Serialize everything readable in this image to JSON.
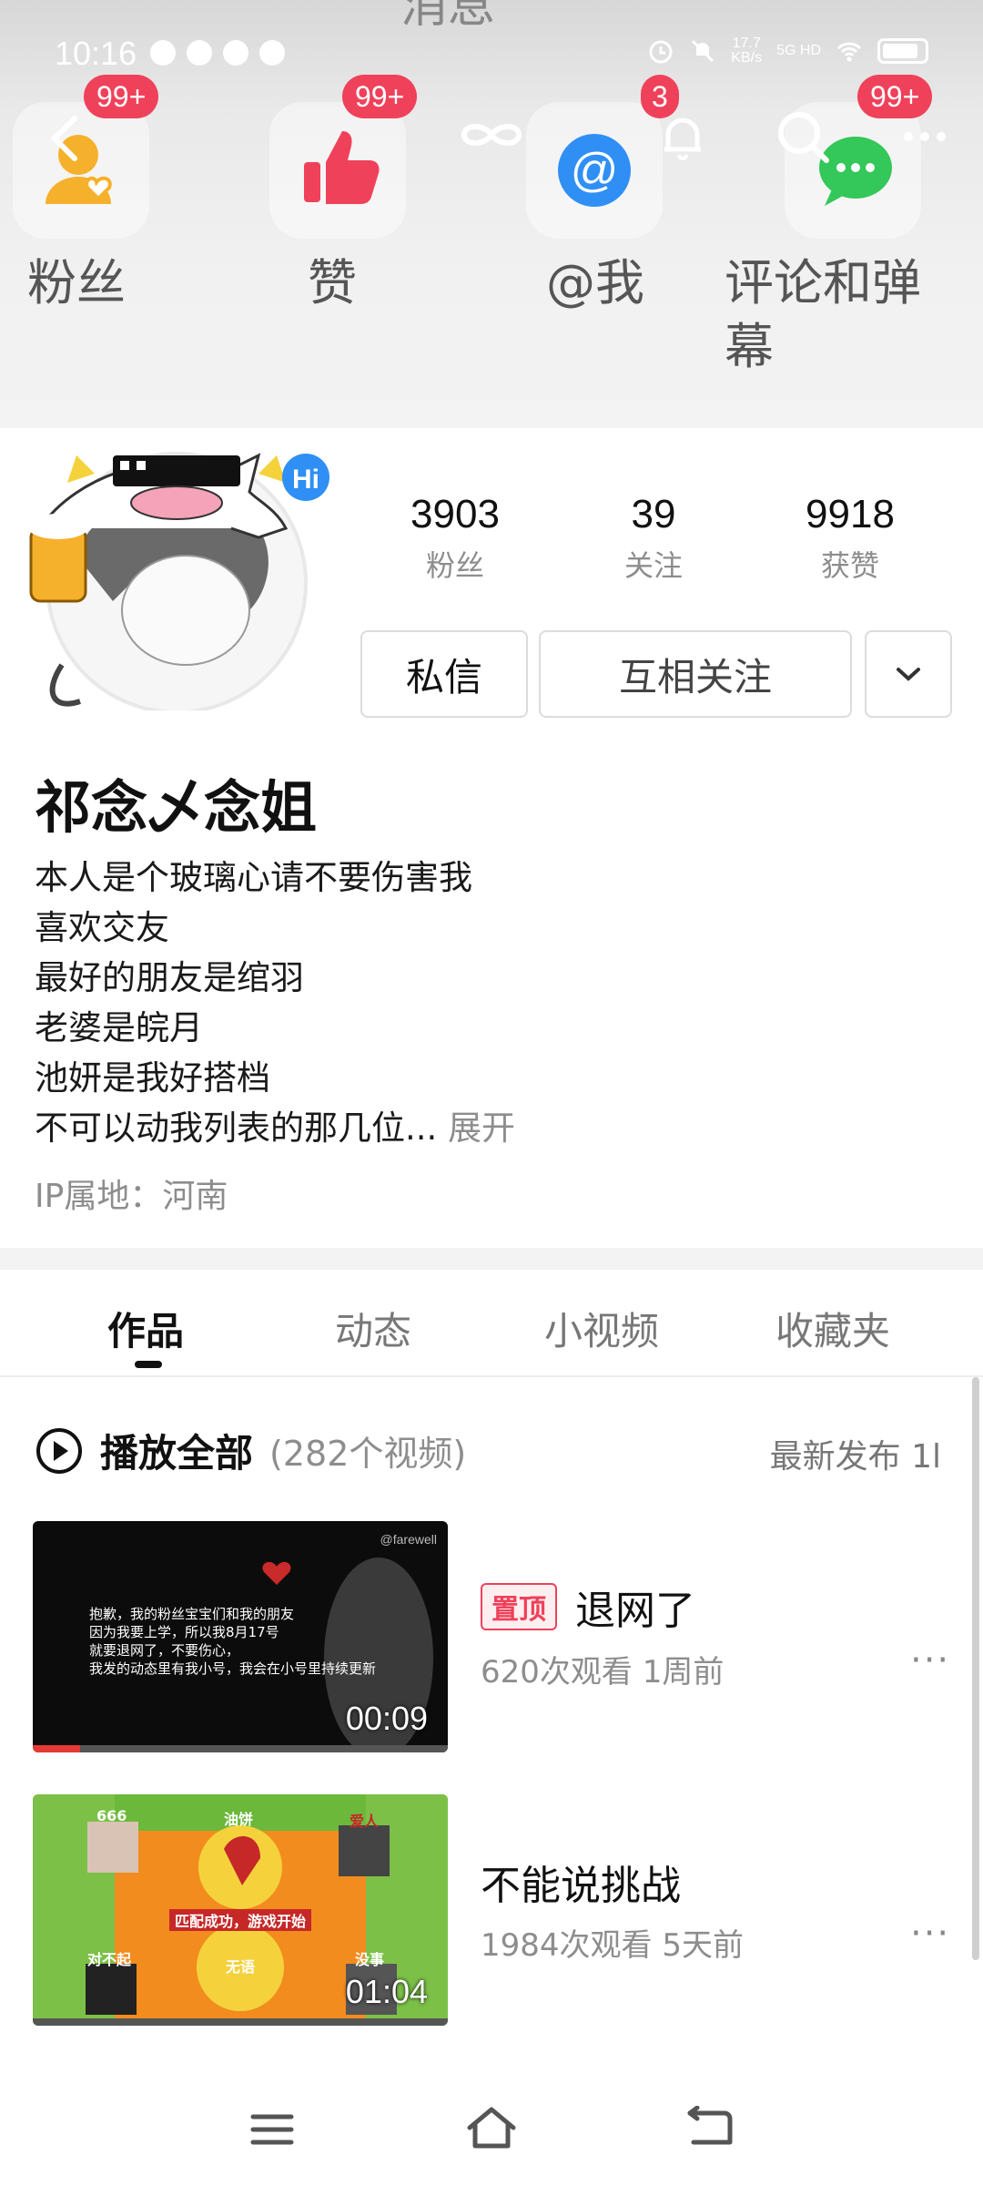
{
  "status_bar": {
    "time": "10:16",
    "speed_value": "17.7",
    "speed_unit": "KB/s",
    "network": "5G HD"
  },
  "header": {
    "ghost_title": "消息"
  },
  "message_categories": [
    {
      "label": "粉丝",
      "badge": "99+",
      "icon": "fans-icon",
      "color": "#f5a623"
    },
    {
      "label": "赞",
      "badge": "99+",
      "icon": "like-icon",
      "color": "#f0415a"
    },
    {
      "label": "@我",
      "badge": "3",
      "icon": "at-icon",
      "color": "#2f8ff5"
    },
    {
      "label": "评论和弹幕",
      "badge": "99+",
      "icon": "comment-icon",
      "color": "#34c759"
    }
  ],
  "profile": {
    "stats": [
      {
        "value": "3903",
        "label": "粉丝"
      },
      {
        "value": "39",
        "label": "关注"
      },
      {
        "value": "9918",
        "label": "获赞"
      }
    ],
    "message_button": "私信",
    "follow_button": "互相关注",
    "username": "祁念乄念姐",
    "bio": [
      "本人是个玻璃心请不要伤害我",
      "喜欢交友",
      "最好的朋友是绾羽",
      "老婆是皖月",
      "池妍是我好搭档",
      "不可以动我列表的那几位..."
    ],
    "expand": "展开",
    "ip_location": "IP属地：河南"
  },
  "tabs": [
    {
      "label": "作品",
      "active": true
    },
    {
      "label": "动态",
      "active": false
    },
    {
      "label": "小视频",
      "active": false
    },
    {
      "label": "收藏夹",
      "active": false
    }
  ],
  "playlist": {
    "play_all": "播放全部",
    "count": "(282个视频)",
    "sort": "最新发布 1l"
  },
  "videos": [
    {
      "pin_label": "置顶",
      "title": "退网了",
      "views": "620次观看",
      "age": "1周前",
      "duration": "00:09",
      "thumb_text": [
        "抱歉，我的粉丝宝宝们和我的朋友",
        "因为我要上学，所以我8月17号",
        "就要退网了，不要伤心，",
        "我发的动态里有我小号，我会在小号里持续更新"
      ],
      "thumb_top_right": "@farewell"
    },
    {
      "title": "不能说挑战",
      "views": "1984次观看",
      "age": "5天前",
      "duration": "01:04",
      "thumb_labels": [
        "666",
        "油饼",
        "爱人",
        "对不起",
        "无语",
        "没事"
      ],
      "thumb_banner": "匹配成功，游戏开始"
    }
  ]
}
